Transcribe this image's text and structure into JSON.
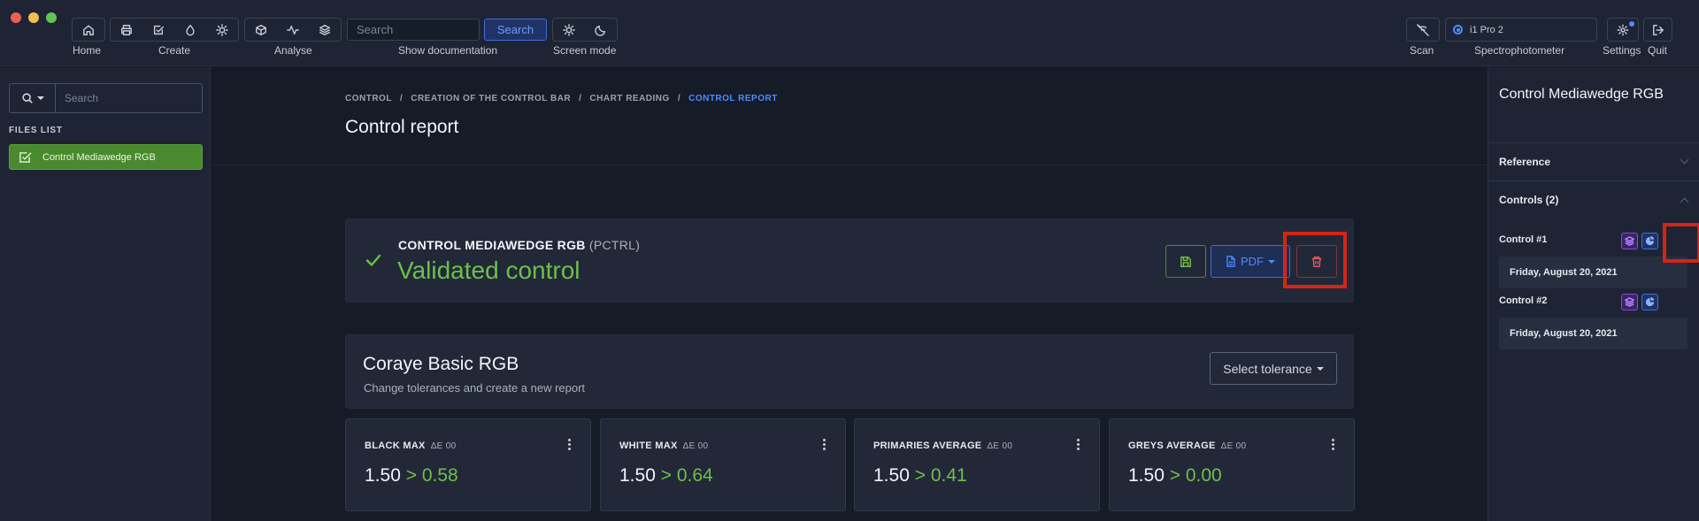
{
  "toolbar": {
    "home_label": "Home",
    "create_label": "Create",
    "analyse_label": "Analyse",
    "search_placeholder": "Search",
    "search_button": "Search",
    "docs_label": "Show documentation",
    "screen_mode_label": "Screen mode",
    "scan_label": "Scan",
    "device_value": "i1 Pro 2",
    "device_label": "Spectrophotometer",
    "settings_label": "Settings",
    "quit_label": "Quit"
  },
  "sidebar": {
    "search_placeholder": "Search",
    "files_title": "FILES LIST",
    "files": [
      {
        "label": "Control Mediawedge RGB"
      }
    ]
  },
  "main": {
    "breadcrumb": [
      "CONTROL",
      "/",
      "CREATION OF THE CONTROL BAR",
      "/",
      "CHART READING",
      "/",
      "CONTROL REPORT"
    ],
    "title": "Control report",
    "status": {
      "name": "CONTROL MEDIAWEDGE RGB",
      "code": "(PCTRL)",
      "result": "Validated control",
      "pdf_label": "PDF"
    },
    "tolerance": {
      "title": "Coraye Basic RGB",
      "subtitle": "Change tolerances and create a new report",
      "select_label": "Select tolerance"
    },
    "metrics": [
      {
        "label": "BLACK MAX",
        "unit": "ΔE 00",
        "limit": "1.50",
        "value": "> 0.58"
      },
      {
        "label": "WHITE MAX",
        "unit": "ΔE 00",
        "limit": "1.50",
        "value": "> 0.64"
      },
      {
        "label": "PRIMARIES AVERAGE",
        "unit": "ΔE 00",
        "limit": "1.50",
        "value": "> 0.41"
      },
      {
        "label": "GREYS AVERAGE",
        "unit": "ΔE 00",
        "limit": "1.50",
        "value": "> 0.00"
      }
    ]
  },
  "rpanel": {
    "title": "Control Mediawedge RGB",
    "reference_label": "Reference",
    "controls_label": "Controls (2)",
    "controls": [
      {
        "label": "Control #1",
        "date": "Friday, August 20, 2021"
      },
      {
        "label": "Control #2",
        "date": "Friday, August 20, 2021"
      }
    ]
  },
  "colors": {
    "accent": "#4a8dff",
    "success": "#6cc04a",
    "danger": "#e05a5a",
    "highlight": "#d42418"
  },
  "icons": [
    "home-icon",
    "print-icon",
    "checkbox-icon",
    "drop-icon",
    "sun-icon",
    "cube-icon",
    "activity-icon",
    "layers-icon",
    "moon-icon",
    "scan-off-icon",
    "settings-icon",
    "logout-icon",
    "search-icon",
    "save-icon",
    "file-icon",
    "trash-icon",
    "chart-icon"
  ]
}
